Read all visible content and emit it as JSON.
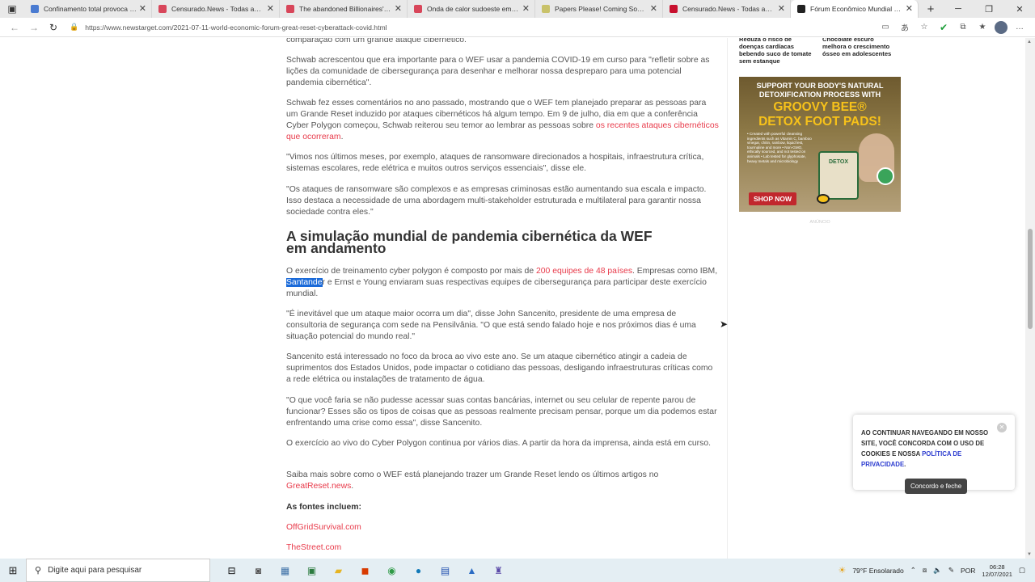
{
  "browser": {
    "tabs": [
      {
        "title": "Confinamento total provoca fuç",
        "favicon_color": "#4a7bd1",
        "active": false
      },
      {
        "title": "Censurado.News - Todas as not",
        "favicon_color": "#d8465a",
        "active": false
      },
      {
        "title": "The abandoned Billionaires' Ro",
        "favicon_color": "#d8465a",
        "active": false
      },
      {
        "title": "Onda de calor sudoeste em má",
        "favicon_color": "#d8465a",
        "active": false
      },
      {
        "title": "Papers Please! Coming Soon, 'I",
        "favicon_color": "#c9c26a",
        "active": false
      },
      {
        "title": "Censurado.News - Todas as not",
        "favicon_color": "#c8102e",
        "active": false
      },
      {
        "title": "Fórum Econômico Mundial prev",
        "favicon_color": "#222222",
        "active": true
      }
    ],
    "url": "https://www.newstarget.com/2021-07-11-world-economic-forum-great-reset-cyberattack-covid.html"
  },
  "sidebar": {
    "news": [
      {
        "title": "Reduza o risco de doenças cardíacas bebendo suco de tomate sem estanque"
      },
      {
        "title": "Chocolate escuro melhora o crescimento ósseo em adolescentes"
      }
    ],
    "ad": {
      "line1": "SUPPORT YOUR BODY'S NATURAL DETOXIFICATION PROCESS WITH",
      "line2": "GROOVY BEE®",
      "line3": "DETOX FOOT PADS!",
      "bullets": "• Created with powerful cleansing ingredients such as Vitamin C, bamboo vinegar, chitin, rainbow, liquid lest, tourmaline and more • Non-GMO, ethically sourced, and not tested on animals • Lab tested for glyphosate, heavy metals and microbiology",
      "jar_label": "DETOX",
      "shop_label": "SHOP NOW",
      "small_label": "ANÚNCIO"
    }
  },
  "article": {
    "p0": "comparação com um grande ataque cibernético.",
    "p1": "Schwab acrescentou que era importante para o WEF usar a pandemia COVID-19 em curso para \"refletir sobre as lições da comunidade de cibersegurança para desenhar e melhorar nossa despreparo para uma potencial pandemia cibernética\".",
    "p2_text": "Schwab fez esses comentários no ano passado, mostrando que o WEF tem planejado preparar as pessoas para um Grande Reset induzido por ataques cibernéticos há algum tempo. Em 9 de julho, dia em que a conferência Cyber Polygon começou, Schwab reiterou seu temor ao lembrar as pessoas sobre",
    "p2_link": "os recentes ataques cibernéticos que ocorreram",
    "p3": "\"Vimos nos últimos meses, por exemplo, ataques de ransomware direcionados a hospitais, infraestrutura crítica, sistemas escolares, rede elétrica e muitos outros serviços essenciais\", disse ele.",
    "p4": "\"Os ataques de ransomware são complexos e as empresas criminosas estão aumentando sua escala e impacto. Isso destaca a necessidade de uma abordagem multi-stakeholder estruturada e multilateral para garantir nossa sociedade contra eles.\"",
    "heading": "A simulação mundial de pandemia cibernética da WEF em andamento",
    "p5_a": "O exercício de treinamento cyber polygon é composto por mais de",
    "p5_link": "200 equipes de 48 países",
    "p5_b": ". Empresas como IBM,",
    "p5_sel": "Santande",
    "p5_c": "r e Ernst e Young enviaram suas respectivas equipes de cibersegurança para participar deste exercício mundial.",
    "p6": "\"É inevitável que um ataque maior ocorra um dia\", disse John Sancenito, presidente de uma empresa de consultoria de segurança com sede na Pensilvânia. \"O que está sendo falado hoje e nos próximos dias é uma situação potencial do mundo real.\"",
    "p7": "Sancenito está interessado no foco da broca ao vivo este ano. Se um ataque cibernético atingir a cadeia de suprimentos dos Estados Unidos, pode impactar o cotidiano das pessoas, desligando infraestruturas críticas como a rede elétrica ou instalações de tratamento de água.",
    "p8": "\"O que você faria se não pudesse acessar suas contas bancárias, internet ou seu celular de repente parou de funcionar? Esses são os tipos de coisas que as pessoas realmente precisam pensar, porque um dia podemos estar enfrentando uma crise como essa\", disse Sancenito.",
    "p9": "O exercício ao vivo do Cyber Polygon continua por vários dias. A partir da hora da imprensa, ainda está em curso.",
    "p10_text": "Saiba mais sobre como o WEF está planejando trazer um Grande Reset lendo os últimos artigos no",
    "p10_link": "GreatReset.news",
    "sources_label": "As fontes incluem:",
    "source1": "OffGridSurvival.com",
    "source2": "TheStreet.com"
  },
  "cookie": {
    "text": "AO CONTINUAR NAVEGANDO EM NOSSO SITE, VOCÊ CONCORDA COM O USO DE COOKIES E NOSSA",
    "policy": "POLÍTICA DE PRIVACIDADE",
    "button": "Concordo e feche"
  },
  "taskbar": {
    "search_placeholder": "Digite aqui para pesquisar",
    "weather": "79°F  Ensolarado",
    "lang": "POR",
    "time": "06:28",
    "date": "12/07/2021"
  }
}
